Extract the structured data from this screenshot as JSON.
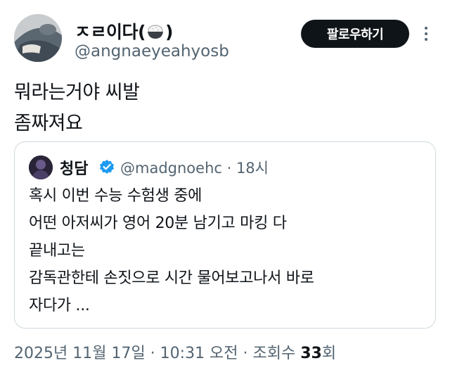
{
  "author": {
    "display_name": "ㅈㄹ이다(",
    "display_name_end": ")",
    "handle": "@angnaeyeahyosb"
  },
  "actions": {
    "follow_label": "팔로우하기"
  },
  "tweet": {
    "lines": [
      "뭐라는거야 씨발",
      "좀짜져요"
    ]
  },
  "quoted": {
    "name": "청담",
    "handle": "@madgnoehc",
    "time": " · 18시",
    "lines": [
      "혹시 이번 수능 수험생 중에",
      "어떤 아저씨가 영어 20분 남기고 마킹 다",
      "끝내고는",
      "감독관한테 손짓으로 시간 물어보고나서 바로",
      "자다가 ..."
    ]
  },
  "meta": {
    "timestamp": "2025년 11월 17일 · 10:31 오전 · 조회수 ",
    "views": "33",
    "views_suffix": "회"
  },
  "colors": {
    "text": "#0f1419",
    "secondary": "#536471",
    "verified": "#1d9bf0",
    "border": "#cfd9de"
  }
}
